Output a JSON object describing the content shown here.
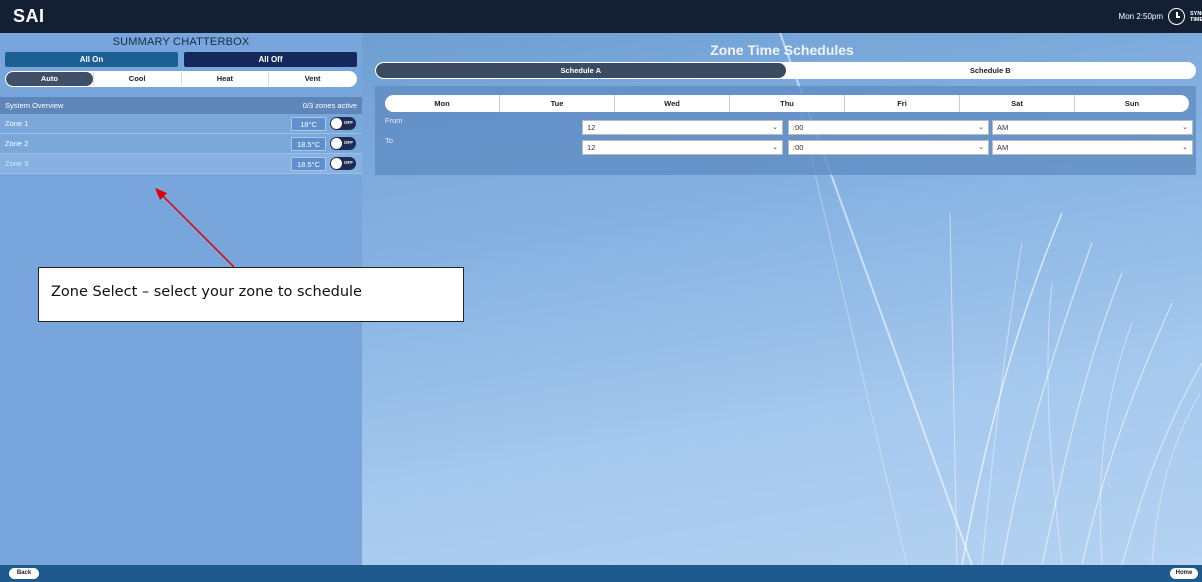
{
  "app": {
    "logo": "SAI",
    "clock": "Mon 2:50pm",
    "sync_label": "SYNC TIME"
  },
  "left_panel": {
    "title": "SUMMARY CHATTERBOX",
    "all_on": "All On",
    "all_off": "All Off",
    "modes": [
      "Auto",
      "Cool",
      "Heat",
      "Vent"
    ],
    "active_mode": "Auto",
    "overview_label": "System Overview",
    "overview_status": "0/3 zones active",
    "zones": [
      {
        "name": "Zone 1",
        "temp": "18°C",
        "toggle": "OFF"
      },
      {
        "name": "Zone 2",
        "temp": "18.5°C",
        "toggle": "OFF"
      },
      {
        "name": "Zone 3",
        "temp": "18.5°C",
        "toggle": "OFF"
      }
    ]
  },
  "main": {
    "title": "Zone Time Schedules",
    "schedule_tabs": [
      "Schedule A",
      "Schedule B"
    ],
    "active_schedule": "Schedule A",
    "days": [
      "Mon",
      "Tue",
      "Wed",
      "Thu",
      "Fri",
      "Sat",
      "Sun"
    ],
    "from": {
      "label": "From",
      "hour": "12",
      "minute": ":00",
      "period": "AM"
    },
    "to": {
      "label": "To",
      "hour": "12",
      "minute": ":00",
      "period": "AM"
    }
  },
  "footer": {
    "back": "Back",
    "home": "Home"
  },
  "annotation": {
    "callout": "Zone Select – select your zone to schedule",
    "arrow_color": "#e00000"
  },
  "colors": {
    "topbar": "#132033",
    "bottombar": "#1f5a8e",
    "all_on": "#1b5f95",
    "all_off": "#15285c",
    "active_tab": "#3a4a5f"
  }
}
